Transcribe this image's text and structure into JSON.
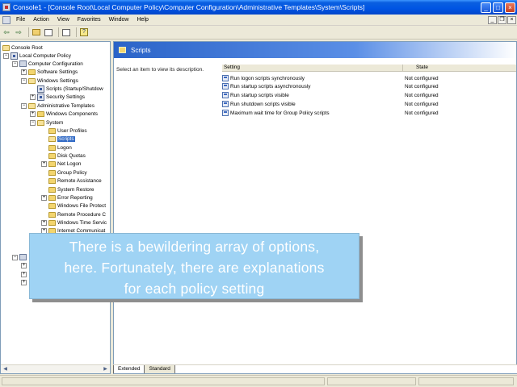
{
  "window": {
    "title": "Console1 - [Console Root\\Local Computer Policy\\Computer Configuration\\Administrative Templates\\System\\Scripts]",
    "minimize": "_",
    "maximize": "□",
    "close": "×"
  },
  "menu": {
    "items": [
      "File",
      "Action",
      "View",
      "Favorites",
      "Window",
      "Help"
    ],
    "mdi_minimize": "_",
    "mdi_restore": "❐",
    "mdi_close": "×"
  },
  "toolbar": {
    "back": "⇦",
    "forward": "⇨"
  },
  "tree": {
    "expand_plus": "+",
    "expand_minus": "−",
    "nodes": [
      {
        "label": "Console Root"
      },
      {
        "label": "Local Computer Policy"
      },
      {
        "label": "Computer Configuration"
      },
      {
        "label": "Software Settings"
      },
      {
        "label": "Windows Settings"
      },
      {
        "label": "Scripts (Startup/Shutdow"
      },
      {
        "label": "Security Settings"
      },
      {
        "label": "Administrative Templates"
      },
      {
        "label": "Windows Components"
      },
      {
        "label": "System"
      },
      {
        "label": "User Profiles"
      },
      {
        "label": "Scripts"
      },
      {
        "label": "Logon"
      },
      {
        "label": "Disk Quotas"
      },
      {
        "label": "Net Logon"
      },
      {
        "label": "Group Policy"
      },
      {
        "label": "Remote Assistance"
      },
      {
        "label": "System Restore"
      },
      {
        "label": "Error Reporting"
      },
      {
        "label": "Windows File Protect"
      },
      {
        "label": "Remote Procedure C"
      },
      {
        "label": "Windows Time Servic"
      },
      {
        "label": "Internet Communicat"
      }
    ],
    "scroll_left": "◀",
    "scroll_right": "▶"
  },
  "details": {
    "header": "Scripts",
    "description_hint": "Select an item to view its description.",
    "columns": {
      "setting": "Setting",
      "state": "State"
    },
    "rows": [
      {
        "setting": "Run logon scripts synchronously",
        "state": "Not configured"
      },
      {
        "setting": "Run startup scripts asynchronously",
        "state": "Not configured"
      },
      {
        "setting": "Run startup scripts visible",
        "state": "Not configured"
      },
      {
        "setting": "Run shutdown scripts visible",
        "state": "Not configured"
      },
      {
        "setting": "Maximum wait time for Group Policy scripts",
        "state": "Not configured"
      }
    ]
  },
  "tabs": [
    "Extended",
    "Standard"
  ],
  "caption": {
    "line1": "There is a bewildering array of options,",
    "line2": "here. Fortunately, there are explanations",
    "line3": "for each policy setting"
  }
}
